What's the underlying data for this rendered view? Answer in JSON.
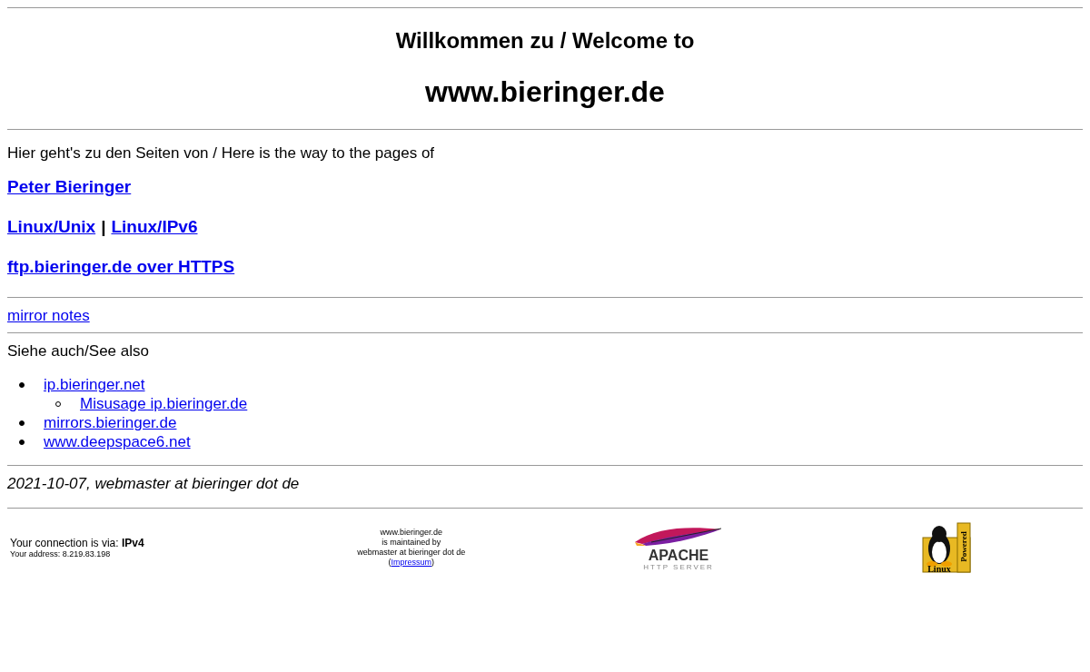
{
  "welcome": "Willkommen zu / Welcome to",
  "site_title": "www.bieringer.de",
  "intro": "Hier geht's zu den Seiten von / Here is the way to the pages of",
  "link_rows": [
    {
      "links": [
        "Peter Bieringer"
      ]
    },
    {
      "links": [
        "Linux/Unix",
        "Linux/IPv6"
      ],
      "separator": "|"
    },
    {
      "links": [
        "ftp.bieringer.de over HTTPS"
      ]
    }
  ],
  "mirror_notes": "mirror notes",
  "see_also": "Siehe auch/See also",
  "see_also_links": [
    {
      "label": "ip.bieringer.net",
      "children": [
        {
          "label": "Misusage ip.bieringer.de"
        }
      ]
    },
    {
      "label": "mirrors.bieringer.de"
    },
    {
      "label": "www.deepspace6.net"
    }
  ],
  "signature": "2021-10-07, webmaster at bieringer dot de",
  "footer": {
    "connection": "Your connection is via: **IPv4**",
    "address": "Your address: 8.219.83.198",
    "maintained_lines": [
      "www.bieringer.de",
      "is maintained by",
      "webmaster at bieringer dot de"
    ],
    "impressum_open": "(",
    "impressum": "Impressum",
    "impressum_close": ")",
    "apache_logo": {
      "word": "APACHE",
      "sub": "HTTP SERVER"
    },
    "linux_logo": {
      "word": "Linux",
      "sub": "Powered"
    }
  }
}
